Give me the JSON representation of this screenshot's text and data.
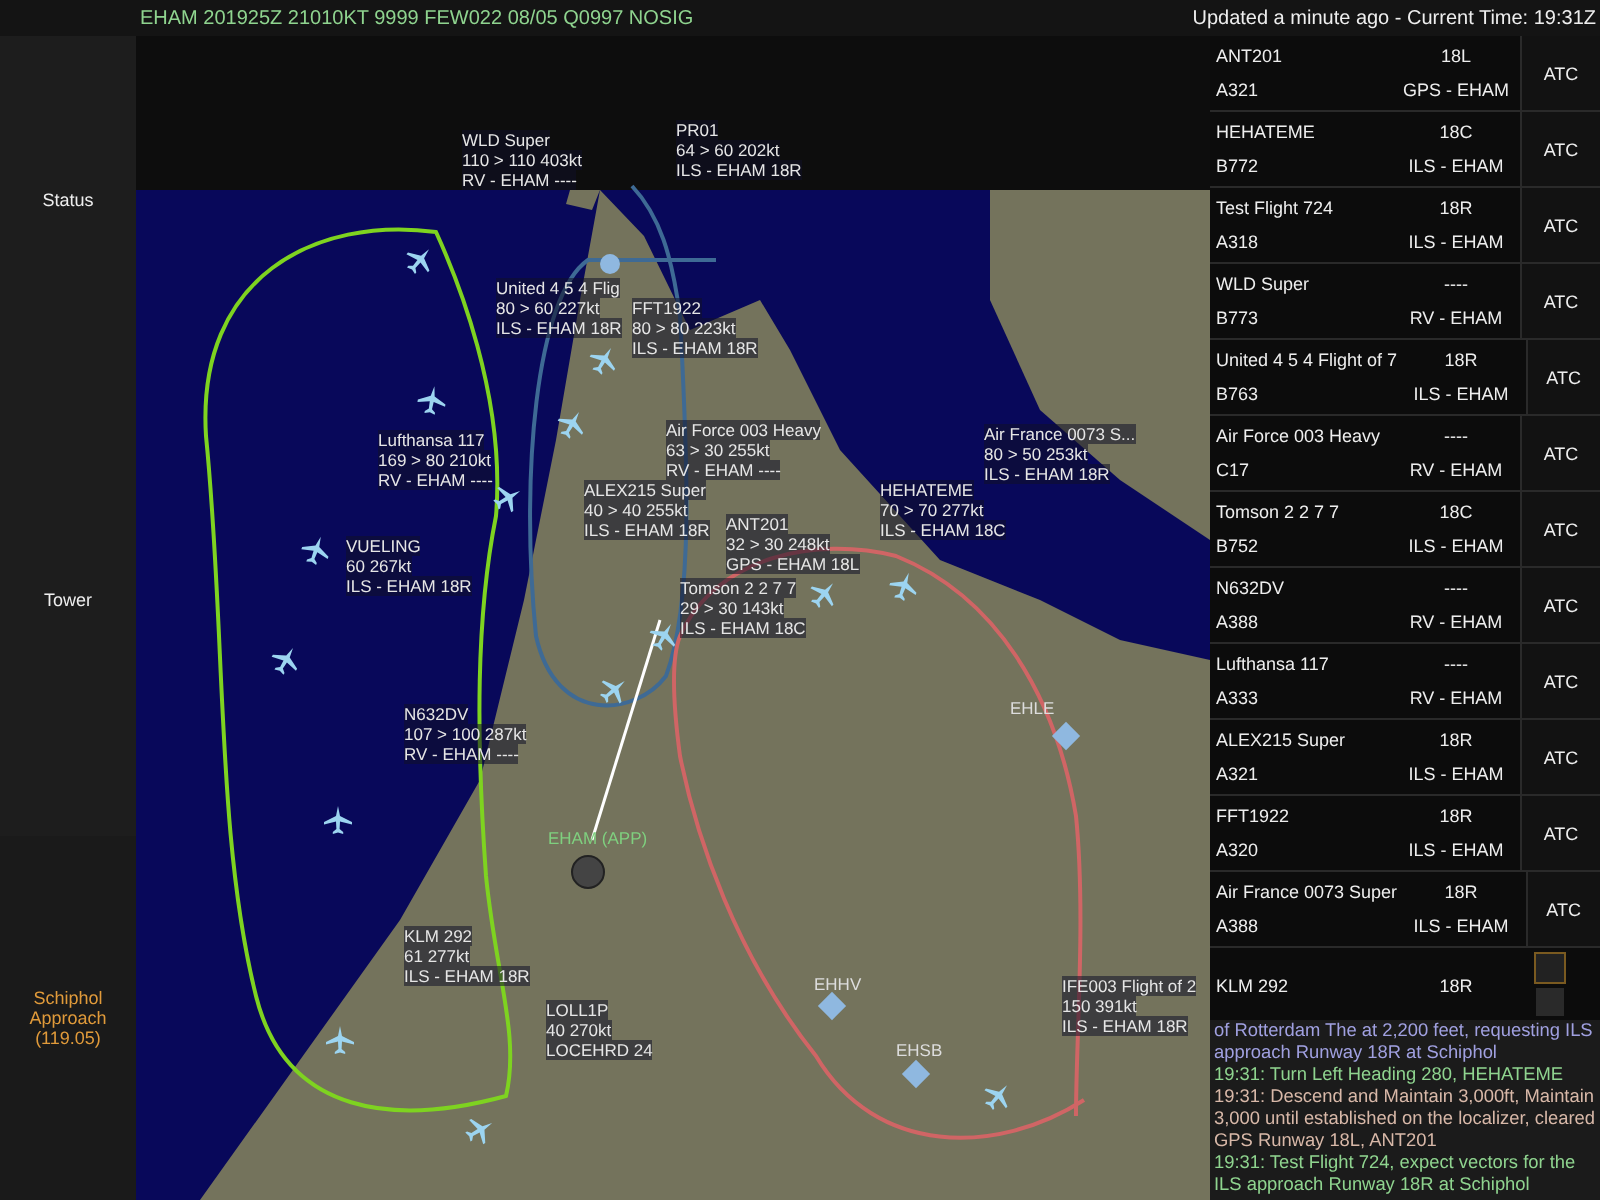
{
  "top_bar": {
    "metar": "EHAM 201925Z 21010KT 9999 FEW022 08/05 Q0997 NOSIG",
    "status": "Updated a minute ago - Current Time: 19:31Z"
  },
  "sidebar": {
    "items": [
      {
        "label": "Status",
        "selected": false
      },
      {
        "label": "Tower",
        "selected": false
      },
      {
        "label": "Schiphol Approach (119.05)",
        "selected": true
      }
    ]
  },
  "map": {
    "aircraft": [
      {
        "lines": [
          "WLD Super",
          "110 > 110 403kt",
          "RV - EHAM ----"
        ]
      },
      {
        "lines": [
          "PR01",
          "64 > 60 202kt",
          "ILS - EHAM 18R"
        ]
      },
      {
        "lines": [
          "United 4 5 4 Flig",
          "80 > 60 227kt",
          "ILS - EHAM 18R"
        ]
      },
      {
        "lines": [
          "FFT1922",
          "80 > 80 223kt",
          "ILS - EHAM 18R"
        ]
      },
      {
        "lines": [
          "Lufthansa 117",
          "169 > 80 210kt",
          "RV - EHAM ----"
        ]
      },
      {
        "lines": [
          "Air Force 003 Heavy",
          "63 > 30 255kt",
          "RV - EHAM ----"
        ]
      },
      {
        "lines": [
          "ALEX215 Super",
          "40 > 40 255kt",
          "ILS - EHAM 18R"
        ]
      },
      {
        "lines": [
          "Air France 0073 S...",
          "80 > 50 253kt",
          "ILS - EHAM 18R"
        ]
      },
      {
        "lines": [
          "HEHATEME",
          "70 > 70 277kt",
          "ILS - EHAM 18C"
        ]
      },
      {
        "lines": [
          "ANT201",
          "32 > 30 248kt",
          "GPS - EHAM 18L"
        ]
      },
      {
        "lines": [
          "VUELING",
          "60 267kt",
          "ILS - EHAM 18R"
        ]
      },
      {
        "lines": [
          "Tomson 2 2 7 7",
          "29 > 30 143kt",
          "ILS - EHAM 18C"
        ]
      },
      {
        "lines": [
          "N632DV",
          "107 > 100 287kt",
          "RV - EHAM ----"
        ]
      },
      {
        "lines": [
          "KLM 292",
          "61 277kt",
          "ILS - EHAM 18R"
        ]
      },
      {
        "lines": [
          "LOLL1P",
          "40 270kt",
          "LOCEHRD 24"
        ]
      },
      {
        "lines": [
          "IFE003 Flight of 2",
          "150 391kt",
          "ILS - EHAM 18R"
        ]
      }
    ],
    "airports": [
      {
        "label": "EHAM (APP)",
        "kind": "controller"
      },
      {
        "label": "EHLE",
        "kind": "airfield"
      },
      {
        "label": "EHHV",
        "kind": "airfield"
      },
      {
        "label": "EHSB",
        "kind": "airfield"
      }
    ]
  },
  "strips": [
    {
      "callsign": "ANT201",
      "type": "A321",
      "runway": "18L",
      "approach": "GPS - EHAM",
      "button": "ATC"
    },
    {
      "callsign": "HEHATEME",
      "type": "B772",
      "runway": "18C",
      "approach": "ILS - EHAM",
      "button": "ATC"
    },
    {
      "callsign": "Test Flight 724",
      "type": "A318",
      "runway": "18R",
      "approach": "ILS - EHAM",
      "button": "ATC"
    },
    {
      "callsign": "WLD Super",
      "type": "B773",
      "runway": "----",
      "approach": "RV - EHAM",
      "button": "ATC"
    },
    {
      "callsign": "United 4 5 4 Flight of 7",
      "type": "B763",
      "runway": "18R",
      "approach": "ILS - EHAM",
      "button": "ATC"
    },
    {
      "callsign": "Air Force 003 Heavy",
      "type": "C17",
      "runway": "----",
      "approach": "RV - EHAM",
      "button": "ATC"
    },
    {
      "callsign": "Tomson 2 2 7 7",
      "type": "B752",
      "runway": "18C",
      "approach": "ILS - EHAM",
      "button": "ATC"
    },
    {
      "callsign": "N632DV",
      "type": "A388",
      "runway": "----",
      "approach": "RV - EHAM",
      "button": "ATC"
    },
    {
      "callsign": "Lufthansa 117",
      "type": "A333",
      "runway": "----",
      "approach": "RV - EHAM",
      "button": "ATC"
    },
    {
      "callsign": "ALEX215 Super",
      "type": "A321",
      "runway": "18R",
      "approach": "ILS - EHAM",
      "button": "ATC"
    },
    {
      "callsign": "FFT1922",
      "type": "A320",
      "runway": "18R",
      "approach": "ILS - EHAM",
      "button": "ATC"
    },
    {
      "callsign": "Air France 0073 Super",
      "type": "A388",
      "runway": "18R",
      "approach": "ILS - EHAM",
      "button": "ATC"
    },
    {
      "callsign": "KLM 292",
      "runway": "18R"
    }
  ],
  "log": [
    {
      "text": "of Rotterdam The at 2,200 feet, requesting ILS approach Runway 18R at Schiphol",
      "color": "#a0a0e0"
    },
    {
      "text": "19:31: Turn Left Heading 280, HEHATEME",
      "color": "#8fd48f"
    },
    {
      "text": "19:31: Descend and Maintain 3,000ft, Maintain 3,000 until established on the localizer, cleared GPS Runway 18L, ANT201",
      "color": "#d8b8a8"
    },
    {
      "text": "19:31: Test Flight 724, expect vectors for the ILS approach Runway 18R at Schiphol",
      "color": "#8fd48f"
    }
  ]
}
